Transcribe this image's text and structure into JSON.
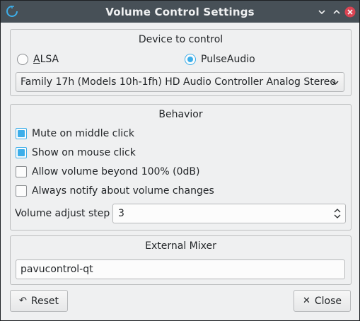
{
  "window": {
    "title": "Volume Control Settings"
  },
  "device_group": {
    "title": "Device to control",
    "radios": [
      {
        "label": "ALSA",
        "checked": false
      },
      {
        "label": "PulseAudio",
        "checked": true
      }
    ],
    "device_select": "Family 17h (Models 10h-1fh) HD Audio Controller Analog Stereo"
  },
  "behavior_group": {
    "title": "Behavior",
    "checkboxes": [
      {
        "label": "Mute on middle click",
        "checked": true
      },
      {
        "label": "Show on mouse click",
        "checked": true
      },
      {
        "label": "Allow volume beyond 100% (0dB)",
        "checked": false
      },
      {
        "label": "Always notify about volume changes",
        "checked": false
      }
    ],
    "volume_step_label": "Volume adjust step",
    "volume_step_value": "3"
  },
  "mixer_group": {
    "title": "External Mixer",
    "command": "pavucontrol-qt"
  },
  "buttons": {
    "reset": "Reset",
    "close": "Close"
  },
  "colors": {
    "accent": "#3daee9",
    "titlebar": "#475057",
    "background": "#eff0f1"
  }
}
